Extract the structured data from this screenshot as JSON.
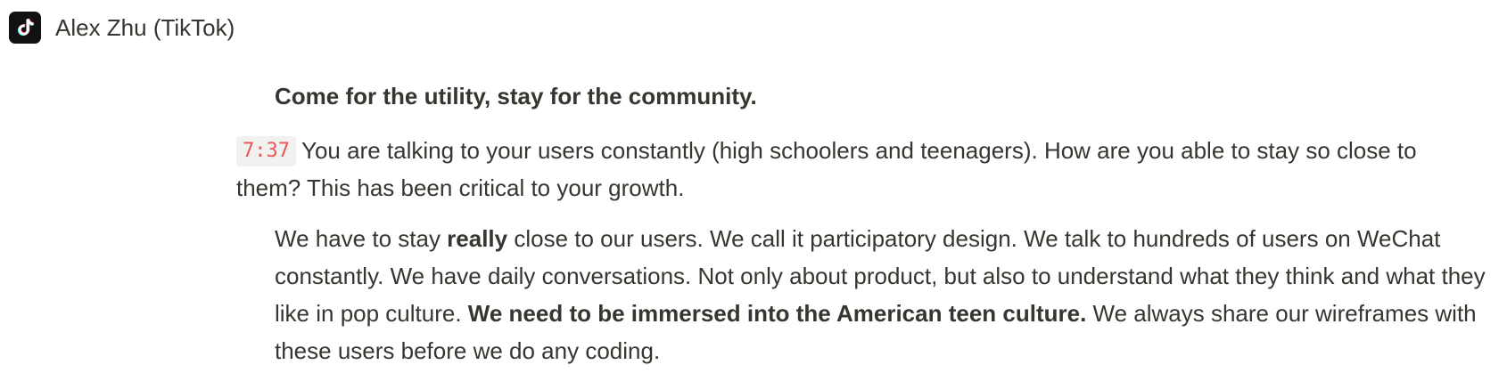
{
  "header": {
    "icon": "tiktok-logo-icon",
    "title": "Alex Zhu (TikTok)"
  },
  "quote": "Come for the utility, stay for the community.",
  "question": {
    "timestamp": "7:37",
    "text": "You are talking to your users constantly (high schoolers and teenagers). How are you able to stay so close to them? This has been critical to your growth."
  },
  "answer": {
    "part1": "We have to stay ",
    "part2_bold": "really",
    "part3": " close to our users. We call it participatory design. We talk to hundreds of users on WeChat constantly. We have daily conversations. Not only about product, but also to understand what they think and what they like in pop culture. ",
    "part4_bold": "We need to be immersed into the American teen culture.",
    "part5": " We always share our wireframes with these users before we do any coding."
  },
  "colors": {
    "text": "#37352f",
    "timestamp": "#eb5757",
    "timestamp_bg": "#f1f1ef",
    "icon_bg": "#111111"
  }
}
